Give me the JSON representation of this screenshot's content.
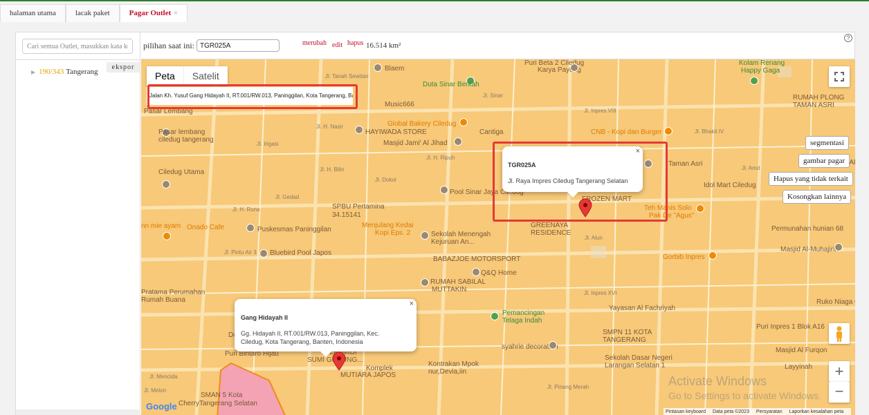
{
  "tabs": [
    {
      "label": "halaman utama"
    },
    {
      "label": "lacak paket"
    },
    {
      "label": "Pagar Outlet",
      "close": "×"
    }
  ],
  "sidebar": {
    "search_placeholder": "Cari semua Outlet, masukkan kata ku",
    "export_label": "ekspor",
    "tree": {
      "count": "190/343",
      "name": "Tangerang"
    }
  },
  "toolbar": {
    "selection_label": "pilihan saat ini:",
    "selection_value": "TGR025A",
    "change_label": "merubah",
    "edit_label": "edit",
    "delete_label": "hapus",
    "area": "16.514 km²",
    "help_icon": "?"
  },
  "map": {
    "type_tabs": [
      "Peta",
      "Satelit"
    ],
    "address_search": "Jalan Kh. Yusuf Gang Hidayah II, RT.001/RW.013, Paninggilan, Kota Tangerang, Banten",
    "popup_outlet": {
      "title": "TGR025A",
      "address": "Jl. Raya Impres Ciledug Tangerang Selatan",
      "close": "×"
    },
    "popup_location": {
      "title": "Gang Hidayah II",
      "address_line1": "Gg. Hidayah II, RT.001/RW.013, Paninggilan, Kec.",
      "address_line2": "Ciledug, Kota Tangerang, Banten, Indonesia",
      "close": "×"
    },
    "right_buttons": [
      "segmentasi",
      "gambar pagar",
      "Hapus yang tidak terkait",
      "Kosongkan lainnya"
    ],
    "zoom_in": "+",
    "zoom_out": "−",
    "google_logo": "Google",
    "attribution": [
      "Pintasan keyboard",
      "Data peta ©2023",
      "Persyaratan",
      "Laporkan kesalahan peta"
    ],
    "activate_windows_title": "Activate Windows",
    "activate_windows_sub": "Go to Settings to activate Windows.",
    "places": [
      {
        "text": "Blaem",
        "kind": "poi"
      },
      {
        "text": "Duta Sinar Berkah",
        "kind": "green"
      },
      {
        "text": "Puri Beta 2 Ciledug",
        "kind": "poi"
      },
      {
        "text": "Karya Payung",
        "kind": "poi"
      },
      {
        "text": "Kolam Renang",
        "kind": "green"
      },
      {
        "text": "Happy Gaga",
        "kind": "green"
      },
      {
        "text": "RUMAH PLONG",
        "kind": "poi"
      },
      {
        "text": "TAMAN ASRI",
        "kind": "poi"
      },
      {
        "text": "Music666",
        "kind": "poi"
      },
      {
        "text": "Pasar Lembang",
        "kind": "poi"
      },
      {
        "text": "Global Bakery Ciledug",
        "kind": "food"
      },
      {
        "text": "Cantiga",
        "kind": "poi"
      },
      {
        "text": "CNB - Kopi dan Burger",
        "kind": "food"
      },
      {
        "text": "Pasar lembang",
        "kind": "poi"
      },
      {
        "text": "ciledug tangerang",
        "kind": "poi"
      },
      {
        "text": "HAYIWADA STORE",
        "kind": "poi"
      },
      {
        "text": "Masjid Jami' Al Jihad",
        "kind": "poi"
      },
      {
        "text": "Ciledug Utama",
        "kind": "poi"
      },
      {
        "text": "Taman Asri",
        "kind": "poi"
      },
      {
        "text": "GLAD",
        "kind": "poi"
      },
      {
        "text": "Pool Sinar Jaya Ciledug",
        "kind": "poi"
      },
      {
        "text": "Idol Mart Ciledug",
        "kind": "poi"
      },
      {
        "text": "FROZEN MART",
        "kind": "poi"
      },
      {
        "text": "SPBU Pertamina",
        "kind": "poi"
      },
      {
        "text": "34.15141",
        "kind": "poi"
      },
      {
        "text": "Teh Manis Solo",
        "kind": "food"
      },
      {
        "text": "Pak De \"Agus\"",
        "kind": "food"
      },
      {
        "text": "nn mie ayam",
        "kind": "food"
      },
      {
        "text": "Onado Cafe",
        "kind": "food"
      },
      {
        "text": "Puskesmas Paninggilan",
        "kind": "poi"
      },
      {
        "text": "Menjulang Kedai",
        "kind": "food"
      },
      {
        "text": "Kopi Eps. 2",
        "kind": "food"
      },
      {
        "text": "Sekolah Menengah",
        "kind": "poi"
      },
      {
        "text": "Kejuruan An...",
        "kind": "poi"
      },
      {
        "text": "GREENAYA",
        "kind": "poi"
      },
      {
        "text": "RESIDENCE",
        "kind": "poi"
      },
      {
        "text": "Permunahan hunian 68",
        "kind": "poi"
      },
      {
        "text": "Masjid Al-Muhajirin",
        "kind": "poi"
      },
      {
        "text": "Bluebird Pool Japos",
        "kind": "poi"
      },
      {
        "text": "BABAZJOE MOTORSPORT",
        "kind": "poi"
      },
      {
        "text": "Gorbib Inpres",
        "kind": "food"
      },
      {
        "text": "Q&Q Home",
        "kind": "poi"
      },
      {
        "text": "RUMAH SABILAL",
        "kind": "poi"
      },
      {
        "text": "MUTTAKIN",
        "kind": "poi"
      },
      {
        "text": "Yayasan Al Fachriyah",
        "kind": "poi"
      },
      {
        "text": "Ruko Niaga Ci",
        "kind": "poi"
      },
      {
        "text": "Pemancingan",
        "kind": "green"
      },
      {
        "text": "Telaga Indah",
        "kind": "green"
      },
      {
        "text": "SMPN 11 KOTA",
        "kind": "poi"
      },
      {
        "text": "TANGERANG",
        "kind": "poi"
      },
      {
        "text": "Puri Inpres 1 Blok A16",
        "kind": "poi"
      },
      {
        "text": "Dody S",
        "kind": "poi"
      },
      {
        "text": "ALFAMIDI",
        "kind": "poi"
      },
      {
        "text": "SUMI GUNUNG...",
        "kind": "poi"
      },
      {
        "text": "syahrie decoration",
        "kind": "poi"
      },
      {
        "text": "Masjid Al Furqon",
        "kind": "poi"
      },
      {
        "text": "Puri Bintaro Hijau",
        "kind": "poi"
      },
      {
        "text": "Kontrakan Mpok",
        "kind": "poi"
      },
      {
        "text": "Komplek",
        "kind": "poi"
      },
      {
        "text": "MUTIARA JAPOS",
        "kind": "poi"
      },
      {
        "text": "nur,Devia,iin",
        "kind": "poi"
      },
      {
        "text": "Sekolah Dasar Negeri",
        "kind": "poi"
      },
      {
        "text": "Larangan Selatan 1",
        "kind": "poi"
      },
      {
        "text": "Layyinah",
        "kind": "poi"
      },
      {
        "text": "Pratama Perumahan",
        "kind": "poi"
      },
      {
        "text": "Rumah Buana",
        "kind": "poi"
      },
      {
        "text": "SMAN 5 Kota",
        "kind": "poi"
      },
      {
        "text": "Tangerang Selatan",
        "kind": "poi"
      },
      {
        "text": "Cherry",
        "kind": "poi"
      }
    ],
    "roads": [
      "Jl. Tanah Sewitan",
      "Jl. Sinar",
      "Jl. Inpres VIII",
      "Jl. Bhakti IV",
      "Jl. Amd",
      "Jl. Irigasi",
      "Jl. H. Nasir",
      "Jl. Dokol",
      "Jl. H. Ripuh",
      "Jl. H. Bilin",
      "Jl. Gedad",
      "Jl. H. Runa",
      "Jl. Pintu Air 3",
      "Jl. Alun",
      "Jl. Inpres XVI",
      "Jl. Pinang Merah",
      "Jl. Melon",
      "Jl. Mencida"
    ]
  }
}
